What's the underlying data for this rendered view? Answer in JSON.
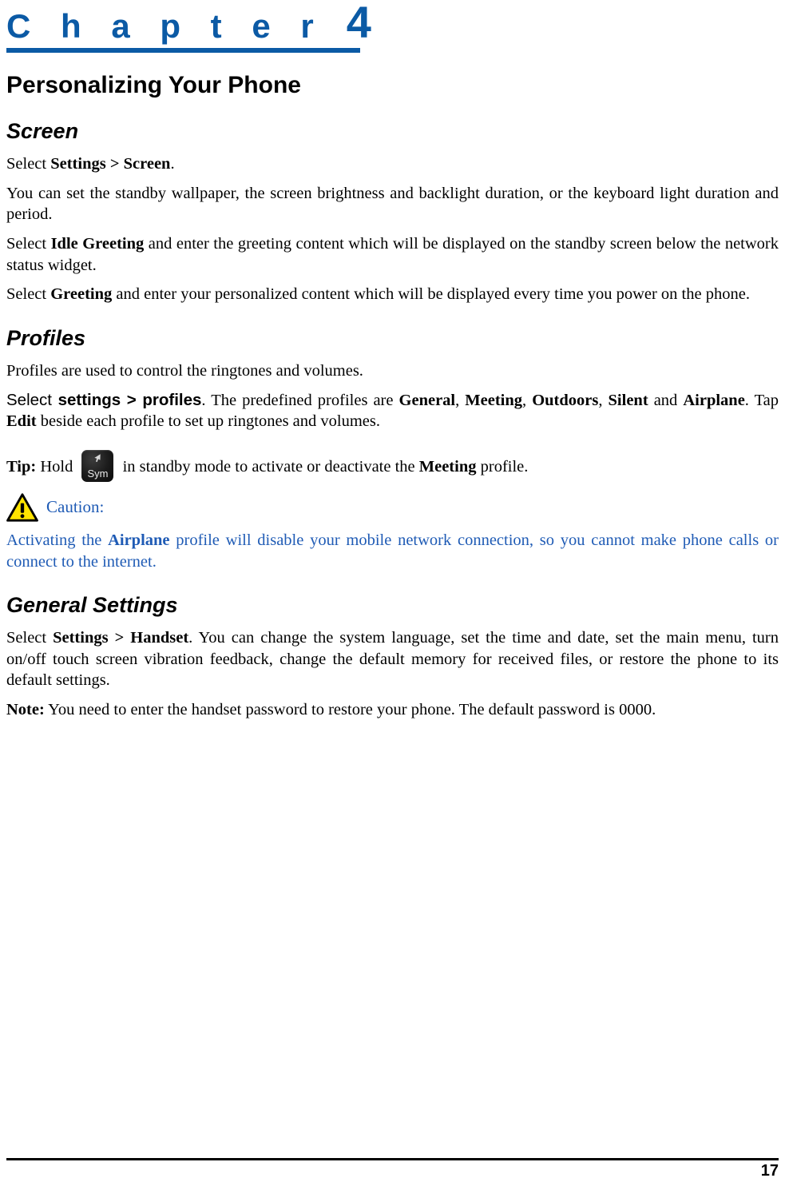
{
  "chapter": {
    "word": "C h a p t e r",
    "number": "4",
    "accent_color": "#0B5AA5"
  },
  "page_title": "Personalizing Your Phone",
  "sections": [
    {
      "heading": "Screen",
      "paragraphs": [
        {
          "parts": [
            {
              "text": "Select ",
              "style": "normal"
            },
            {
              "text": "Settings > Screen",
              "style": "bold"
            },
            {
              "text": ".",
              "style": "normal"
            }
          ]
        },
        {
          "parts": [
            {
              "text": "You can set the standby wallpaper, the screen brightness and backlight duration, or the keyboard light duration and period.",
              "style": "normal"
            }
          ]
        },
        {
          "parts": [
            {
              "text": "Select ",
              "style": "normal"
            },
            {
              "text": "Idle Greeting",
              "style": "bold"
            },
            {
              "text": " and enter the greeting content which will be displayed on the standby screen below the network status widget.",
              "style": "normal"
            }
          ]
        },
        {
          "parts": [
            {
              "text": "Select ",
              "style": "normal"
            },
            {
              "text": "Greeting",
              "style": "bold"
            },
            {
              "text": " and enter your personalized content which will be displayed every time you power on the phone.",
              "style": "normal"
            }
          ]
        }
      ]
    },
    {
      "heading": "Profiles",
      "paragraphs": [
        {
          "parts": [
            {
              "text": "Profiles are used to control the ringtones and volumes.",
              "style": "normal"
            }
          ]
        },
        {
          "parts": [
            {
              "text": "Select ",
              "style": "sans"
            },
            {
              "text": "settings > profiles",
              "style": "sans-bold"
            },
            {
              "text": ". The predefined profiles are ",
              "style": "normal"
            },
            {
              "text": "General",
              "style": "bold"
            },
            {
              "text": ", ",
              "style": "normal"
            },
            {
              "text": "Meeting",
              "style": "bold"
            },
            {
              "text": ", ",
              "style": "normal"
            },
            {
              "text": "Outdoors",
              "style": "bold"
            },
            {
              "text": ", ",
              "style": "normal"
            },
            {
              "text": "Silent",
              "style": "bold"
            },
            {
              "text": " and ",
              "style": "normal"
            },
            {
              "text": "Airplane",
              "style": "bold"
            },
            {
              "text": ". Tap ",
              "style": "normal"
            },
            {
              "text": "Edit",
              "style": "bold"
            },
            {
              "text": " beside each profile to set up ringtones and volumes.",
              "style": "normal"
            }
          ]
        }
      ]
    }
  ],
  "tip": {
    "label": "Tip:",
    "before_icon": " Hold ",
    "icon_name": "sym-key-icon",
    "icon_label": "Sym",
    "after_icon_pre": " in standby mode to activate or deactivate the ",
    "emphasis": "Meeting",
    "after_icon_post": " profile."
  },
  "caution": {
    "icon_name": "warning-triangle-icon",
    "label": "Caution:",
    "color": "#1F5BB5",
    "body_parts": [
      {
        "text": "Activating the ",
        "style": "normal"
      },
      {
        "text": "Airplane",
        "style": "bold"
      },
      {
        "text": " profile will disable your mobile network connection, so you cannot make phone calls or connect to the internet.",
        "style": "normal"
      }
    ]
  },
  "general_settings": {
    "heading": "General Settings",
    "paragraphs": [
      {
        "parts": [
          {
            "text": "Select ",
            "style": "normal"
          },
          {
            "text": "Settings > Handset",
            "style": "bold"
          },
          {
            "text": ". You can change the system language, set the time and date, set the main menu, turn on/off touch screen vibration feedback, change the default memory for received files, or restore the phone to its default settings.",
            "style": "normal"
          }
        ]
      },
      {
        "parts": [
          {
            "text": "Note:",
            "style": "bold"
          },
          {
            "text": " You need to enter the handset password to restore your phone. The default password is 0000.",
            "style": "normal"
          }
        ]
      }
    ]
  },
  "footer": {
    "page_number": "17"
  }
}
